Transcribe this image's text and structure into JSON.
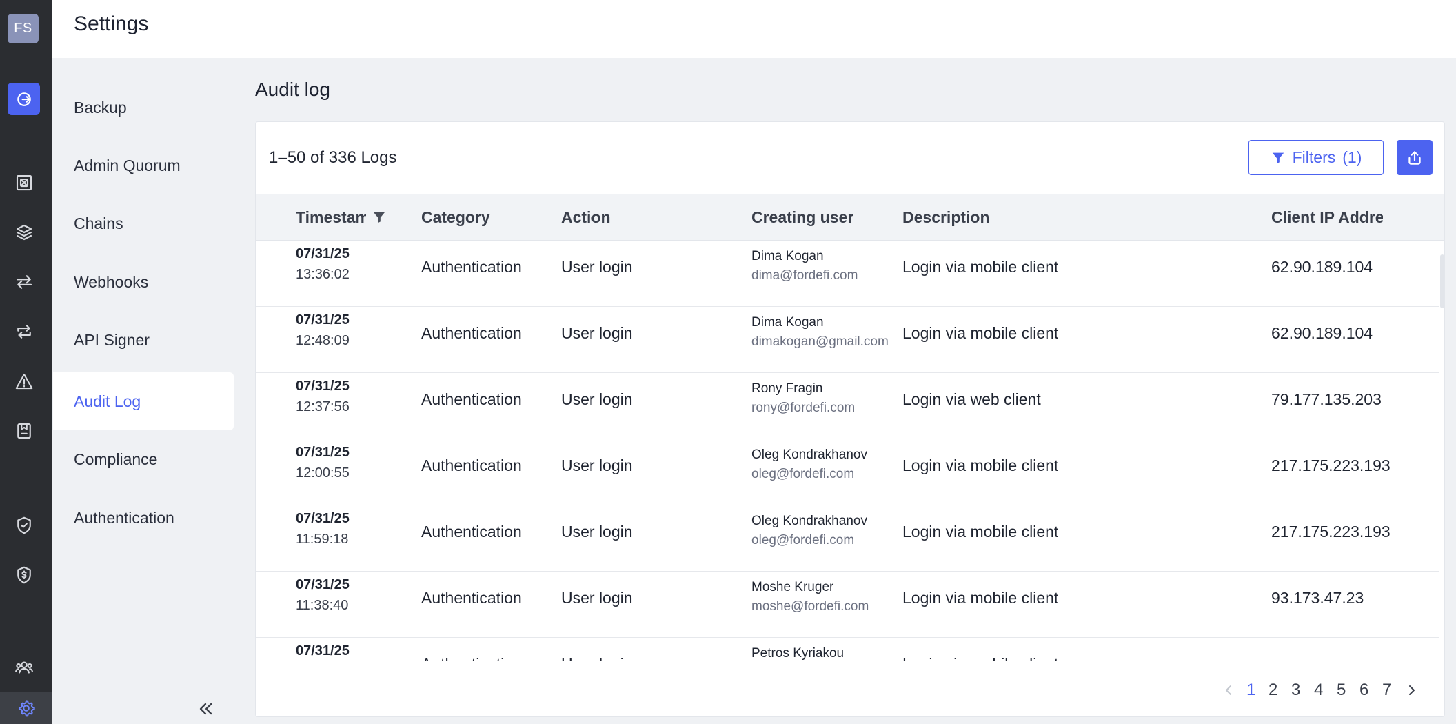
{
  "rail": {
    "avatar_initials": "FS",
    "icons": [
      "logout-icon",
      "vault-icon",
      "layers-icon",
      "transfer-icon",
      "swap-icon",
      "alert-icon",
      "address-book-icon",
      "policy-check-icon",
      "shield-dollar-icon",
      "users-icon",
      "gear-icon"
    ]
  },
  "header": {
    "title": "Settings"
  },
  "subnav": {
    "items": [
      {
        "label": "Backup",
        "active": false
      },
      {
        "label": "Admin Quorum",
        "active": false
      },
      {
        "label": "Chains",
        "active": false
      },
      {
        "label": "Webhooks",
        "active": false
      },
      {
        "label": "API Signer",
        "active": false
      },
      {
        "label": "Audit Log",
        "active": true
      },
      {
        "label": "Compliance",
        "active": false
      },
      {
        "label": "Authentication",
        "active": false
      }
    ]
  },
  "main": {
    "title": "Audit log",
    "count_label": "1–50 of 336 Logs",
    "filters_label": "Filters",
    "filters_count": "(1)",
    "accent_color": "#4c63f0"
  },
  "table": {
    "columns": [
      "Timestam",
      "Category",
      "Action",
      "Creating user",
      "Description",
      "Client IP Addre"
    ],
    "rows": [
      {
        "date": "07/31/25",
        "time": "13:36:02",
        "category": "Authentication",
        "action": "User login",
        "user_name": "Dima Kogan",
        "user_email": "dima@fordefi.com",
        "description": "Login via mobile client",
        "ip": "62.90.189.104"
      },
      {
        "date": "07/31/25",
        "time": "12:48:09",
        "category": "Authentication",
        "action": "User login",
        "user_name": "Dima Kogan",
        "user_email": "dimakogan@gmail.com",
        "description": "Login via mobile client",
        "ip": "62.90.189.104"
      },
      {
        "date": "07/31/25",
        "time": "12:37:56",
        "category": "Authentication",
        "action": "User login",
        "user_name": "Rony Fragin",
        "user_email": "rony@fordefi.com",
        "description": "Login via web client",
        "ip": "79.177.135.203"
      },
      {
        "date": "07/31/25",
        "time": "12:00:55",
        "category": "Authentication",
        "action": "User login",
        "user_name": "Oleg Kondrakhanov",
        "user_email": "oleg@fordefi.com",
        "description": "Login via mobile client",
        "ip": "217.175.223.193"
      },
      {
        "date": "07/31/25",
        "time": "11:59:18",
        "category": "Authentication",
        "action": "User login",
        "user_name": "Oleg Kondrakhanov",
        "user_email": "oleg@fordefi.com",
        "description": "Login via mobile client",
        "ip": "217.175.223.193"
      },
      {
        "date": "07/31/25",
        "time": "11:38:40",
        "category": "Authentication",
        "action": "User login",
        "user_name": "Moshe Kruger",
        "user_email": "moshe@fordefi.com",
        "description": "Login via mobile client",
        "ip": "93.173.47.23"
      },
      {
        "date": "07/31/25",
        "time": "",
        "category": "Authentication",
        "action": "User login",
        "user_name": "Petros Kyriakou",
        "user_email": "",
        "description": "Login via mobile client",
        "ip": ""
      }
    ]
  },
  "pagination": {
    "pages": [
      "1",
      "2",
      "3",
      "4",
      "5",
      "6",
      "7"
    ],
    "current": "1"
  }
}
